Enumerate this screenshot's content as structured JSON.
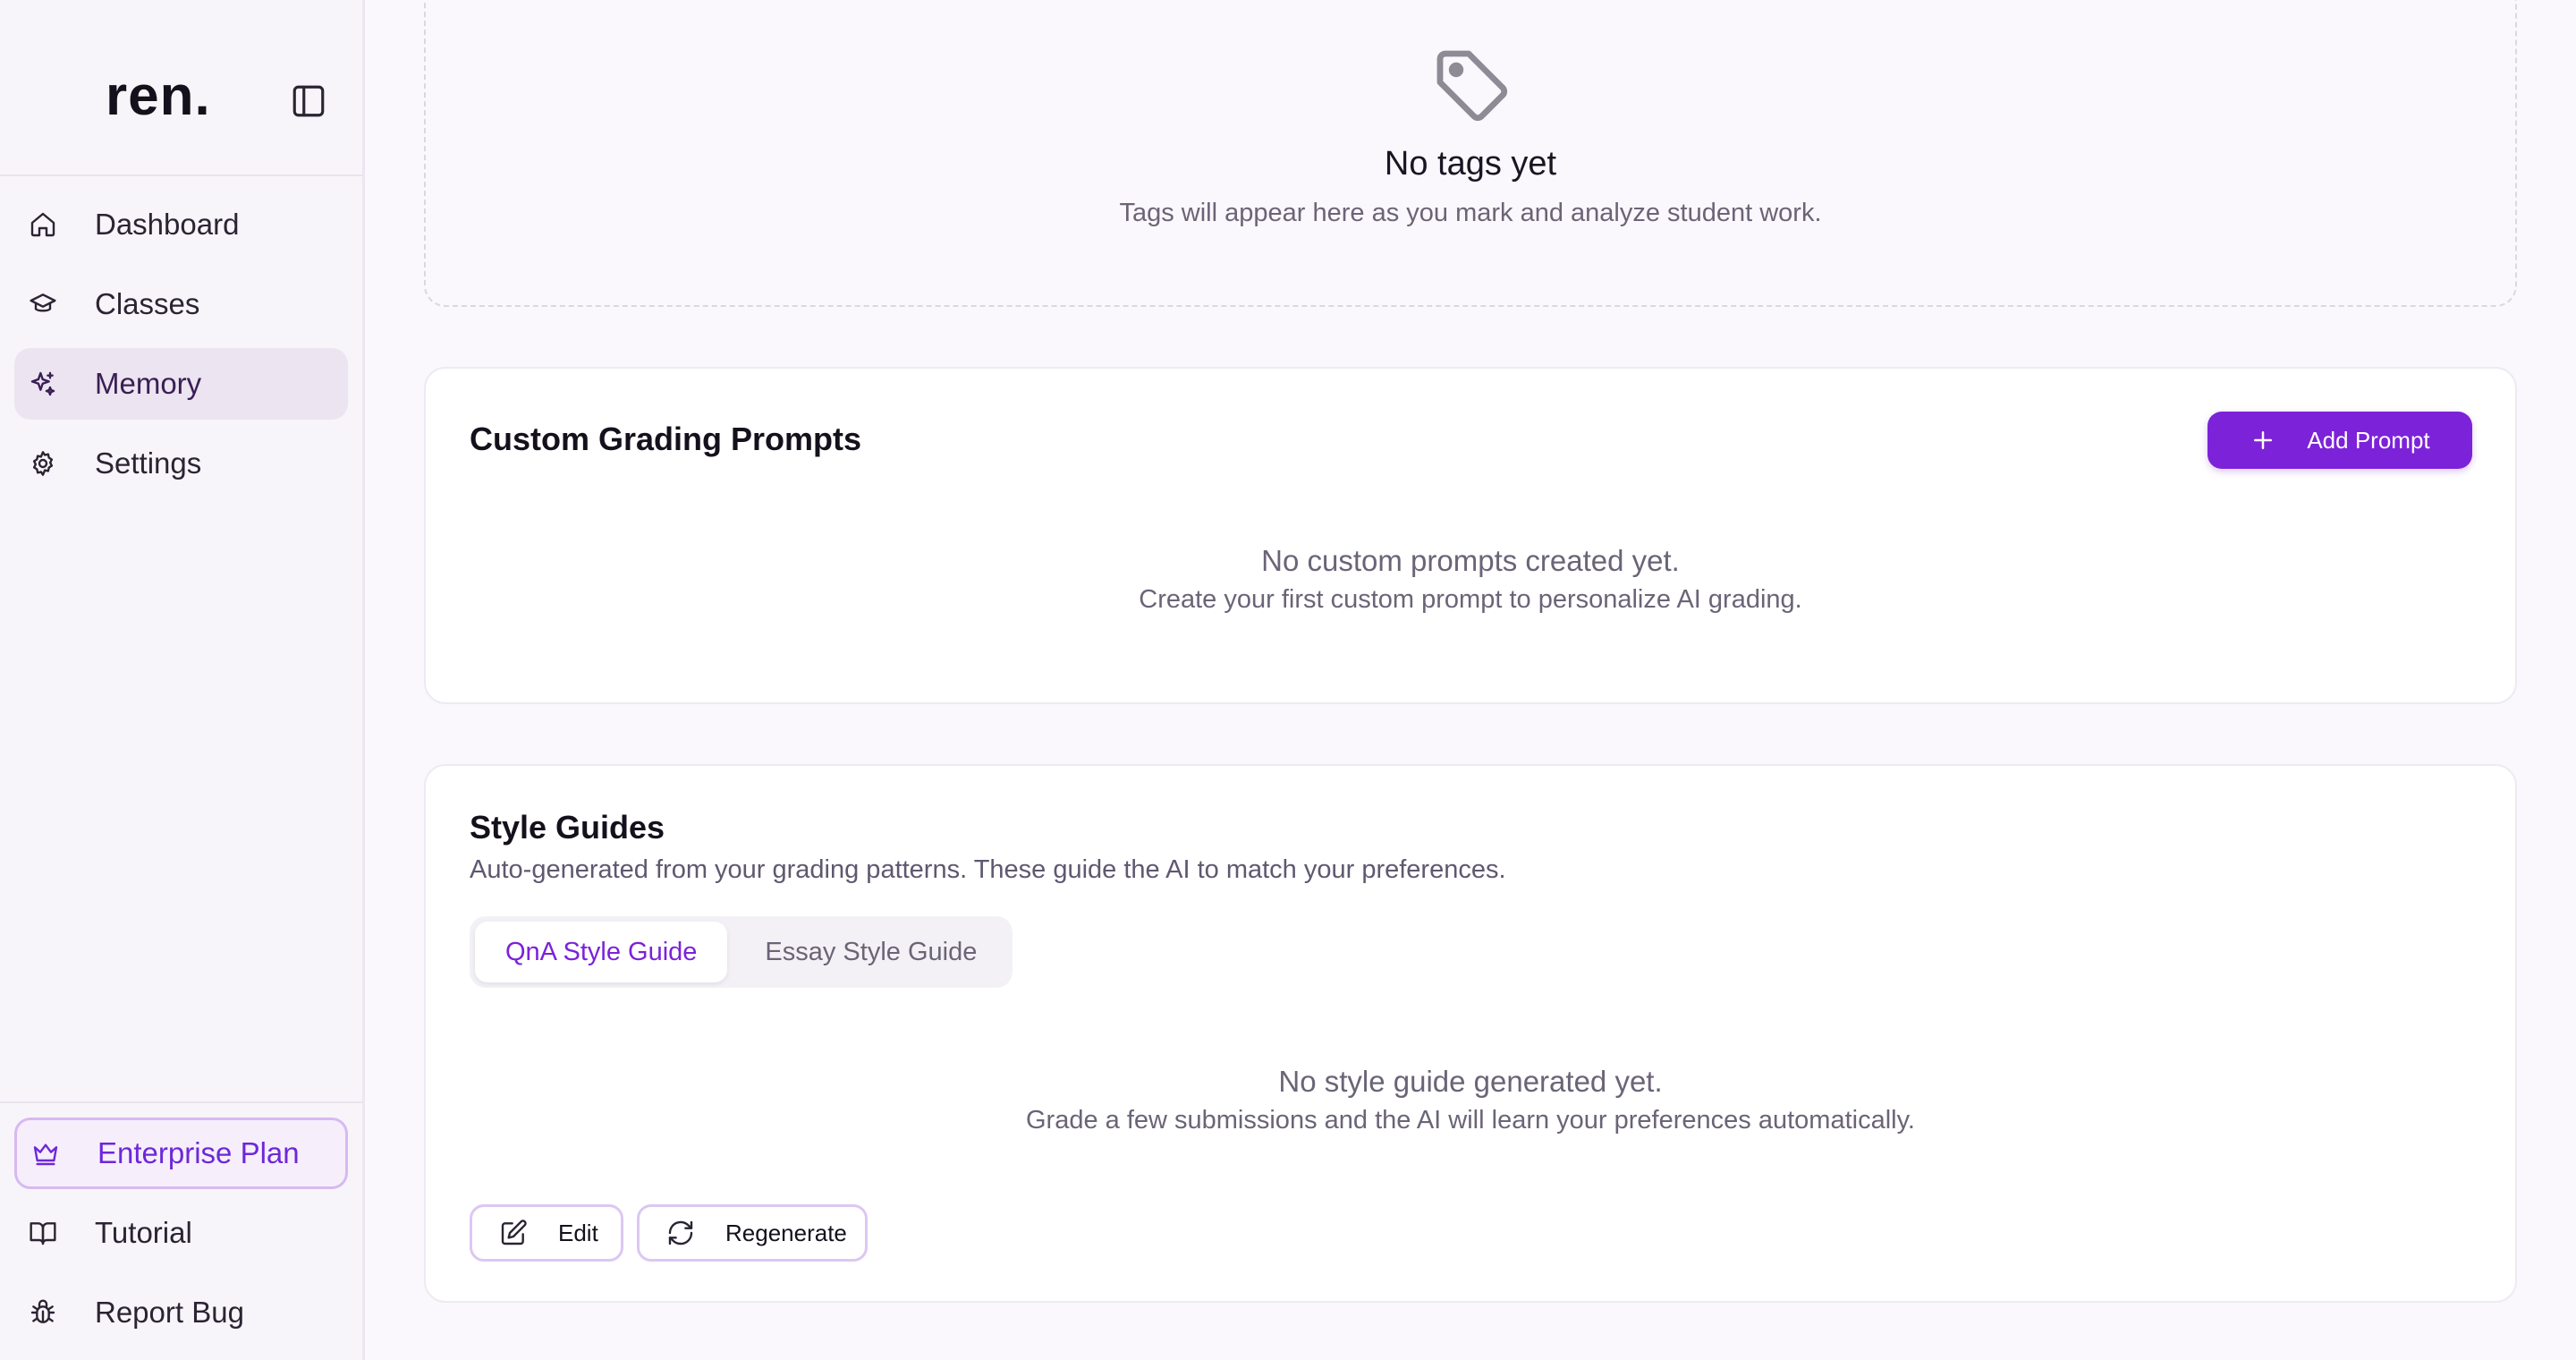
{
  "app": {
    "logo": "ren."
  },
  "sidebar": {
    "items": [
      {
        "label": "Dashboard",
        "icon": "home-icon",
        "active": false
      },
      {
        "label": "Classes",
        "icon": "graduation-cap-icon",
        "active": false
      },
      {
        "label": "Memory",
        "icon": "sparkles-icon",
        "active": true
      },
      {
        "label": "Settings",
        "icon": "gear-icon",
        "active": false
      }
    ],
    "bottom": {
      "plan_label": "Enterprise Plan",
      "tutorial_label": "Tutorial",
      "report_bug_label": "Report Bug"
    }
  },
  "tags": {
    "title": "No tags yet",
    "subtitle": "Tags will appear here as you mark and analyze student work."
  },
  "prompts": {
    "title": "Custom Grading Prompts",
    "add_label": "Add Prompt",
    "empty_title": "No custom prompts created yet.",
    "empty_subtitle": "Create your first custom prompt to personalize AI grading."
  },
  "style_guides": {
    "title": "Style Guides",
    "description": "Auto-generated from your grading patterns. These guide the AI to match your preferences.",
    "tabs": [
      {
        "label": "QnA Style Guide",
        "active": true
      },
      {
        "label": "Essay Style Guide",
        "active": false
      }
    ],
    "empty_title": "No style guide generated yet.",
    "empty_subtitle": "Grade a few submissions and the AI will learn your preferences automatically.",
    "edit_label": "Edit",
    "regenerate_label": "Regenerate"
  },
  "colors": {
    "accent": "#7c22d9",
    "active_nav_bg": "#ece4f0"
  }
}
